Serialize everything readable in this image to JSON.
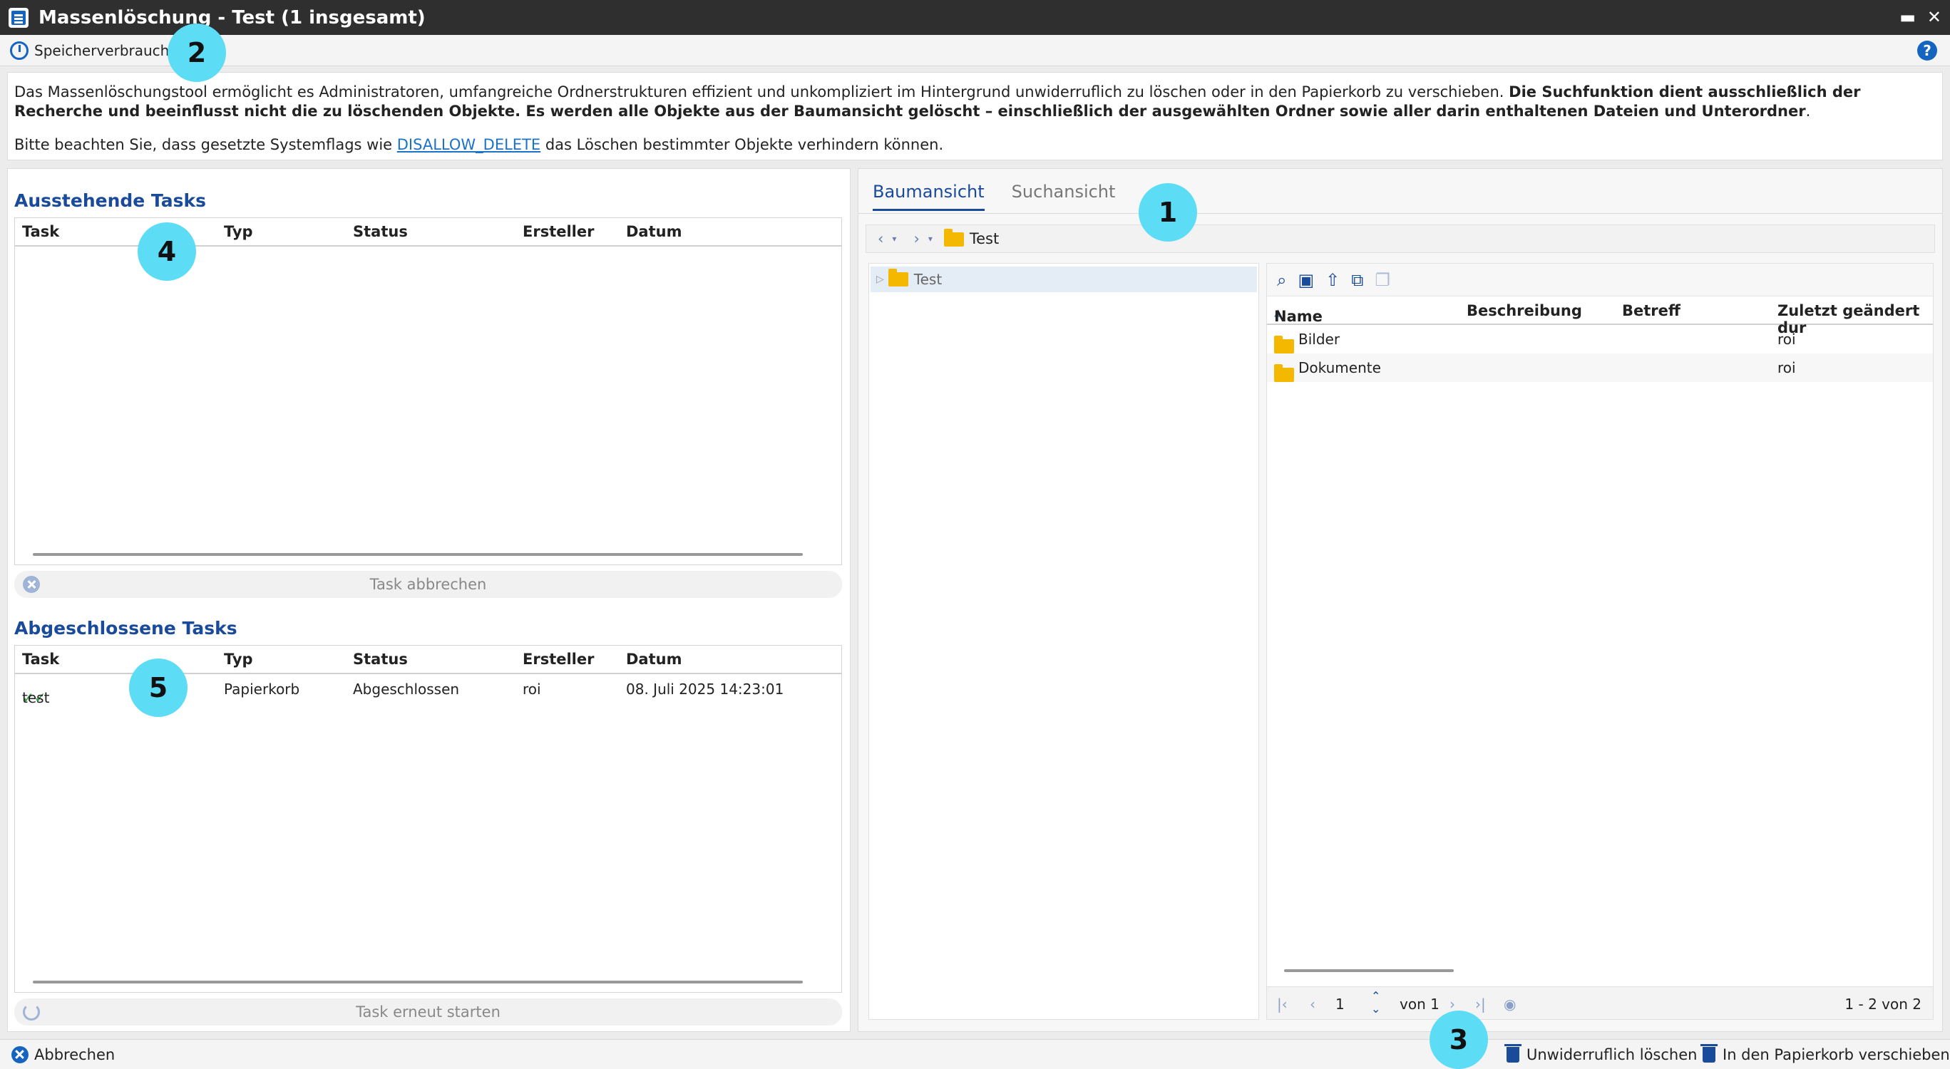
{
  "window": {
    "title": "Massenlöschung - Test (1 insgesamt)",
    "minimize": "▬",
    "close": "✕"
  },
  "toolbar": {
    "storage_label": "Speicherverbrauch",
    "help": "?"
  },
  "info": {
    "text_normal": "Das Massenlöschungstool ermöglicht es Administratoren, umfangreiche Ordnerstrukturen effizient und unkompliziert im Hintergrund unwiderruflich zu löschen oder in den Papierkorb zu verschieben. ",
    "text_bold": "Die Suchfunktion dient ausschließlich der Recherche und beeinflusst nicht die zu löschenden Objekte. Es werden alle Objekte aus der Baumansicht gelöscht – einschließlich der ausgewählten Ordner sowie aller darin enthaltenen Dateien und Unterordner",
    "text_end": ".",
    "note_before": "Bitte beachten Sie, dass gesetzte Systemflags wie ",
    "note_link": "DISALLOW_DELETE",
    "note_after": " das Löschen bestimmter Objekte verhindern können."
  },
  "pending": {
    "title": "Ausstehende Tasks",
    "columns": [
      "Task",
      "Typ",
      "Status",
      "Ersteller",
      "Datum"
    ],
    "cancel_button": "Task abbrechen"
  },
  "completed": {
    "title": "Abgeschlossene Tasks",
    "columns": [
      "Task",
      "Typ",
      "Status",
      "Ersteller",
      "Datum"
    ],
    "rows": [
      {
        "task": "test",
        "typ": "Papierkorb",
        "status": "Abgeschlossen",
        "ersteller": "roi",
        "datum": "08. Juli 2025 14:23:01"
      }
    ],
    "restart_button": "Task erneut starten"
  },
  "right": {
    "tabs": [
      "Baumansicht",
      "Suchansicht"
    ],
    "breadcrumb": "Test",
    "tree_root": "Test",
    "columns": [
      "Name",
      "Beschreibung",
      "Betreff",
      "Zuletzt geändert dur"
    ],
    "files": [
      {
        "name": "Bilder",
        "modified_by": "roi"
      },
      {
        "name": "Dokumente",
        "modified_by": "roi"
      }
    ],
    "pager": {
      "page": "1",
      "of": "von 1",
      "range": "1 - 2 von 2"
    }
  },
  "bottom": {
    "cancel": "Abbrechen",
    "delete": "Unwiderruflich löschen",
    "trash": "In den Papierkorb verschieben"
  },
  "callouts": [
    "1",
    "2",
    "3",
    "4",
    "5"
  ]
}
